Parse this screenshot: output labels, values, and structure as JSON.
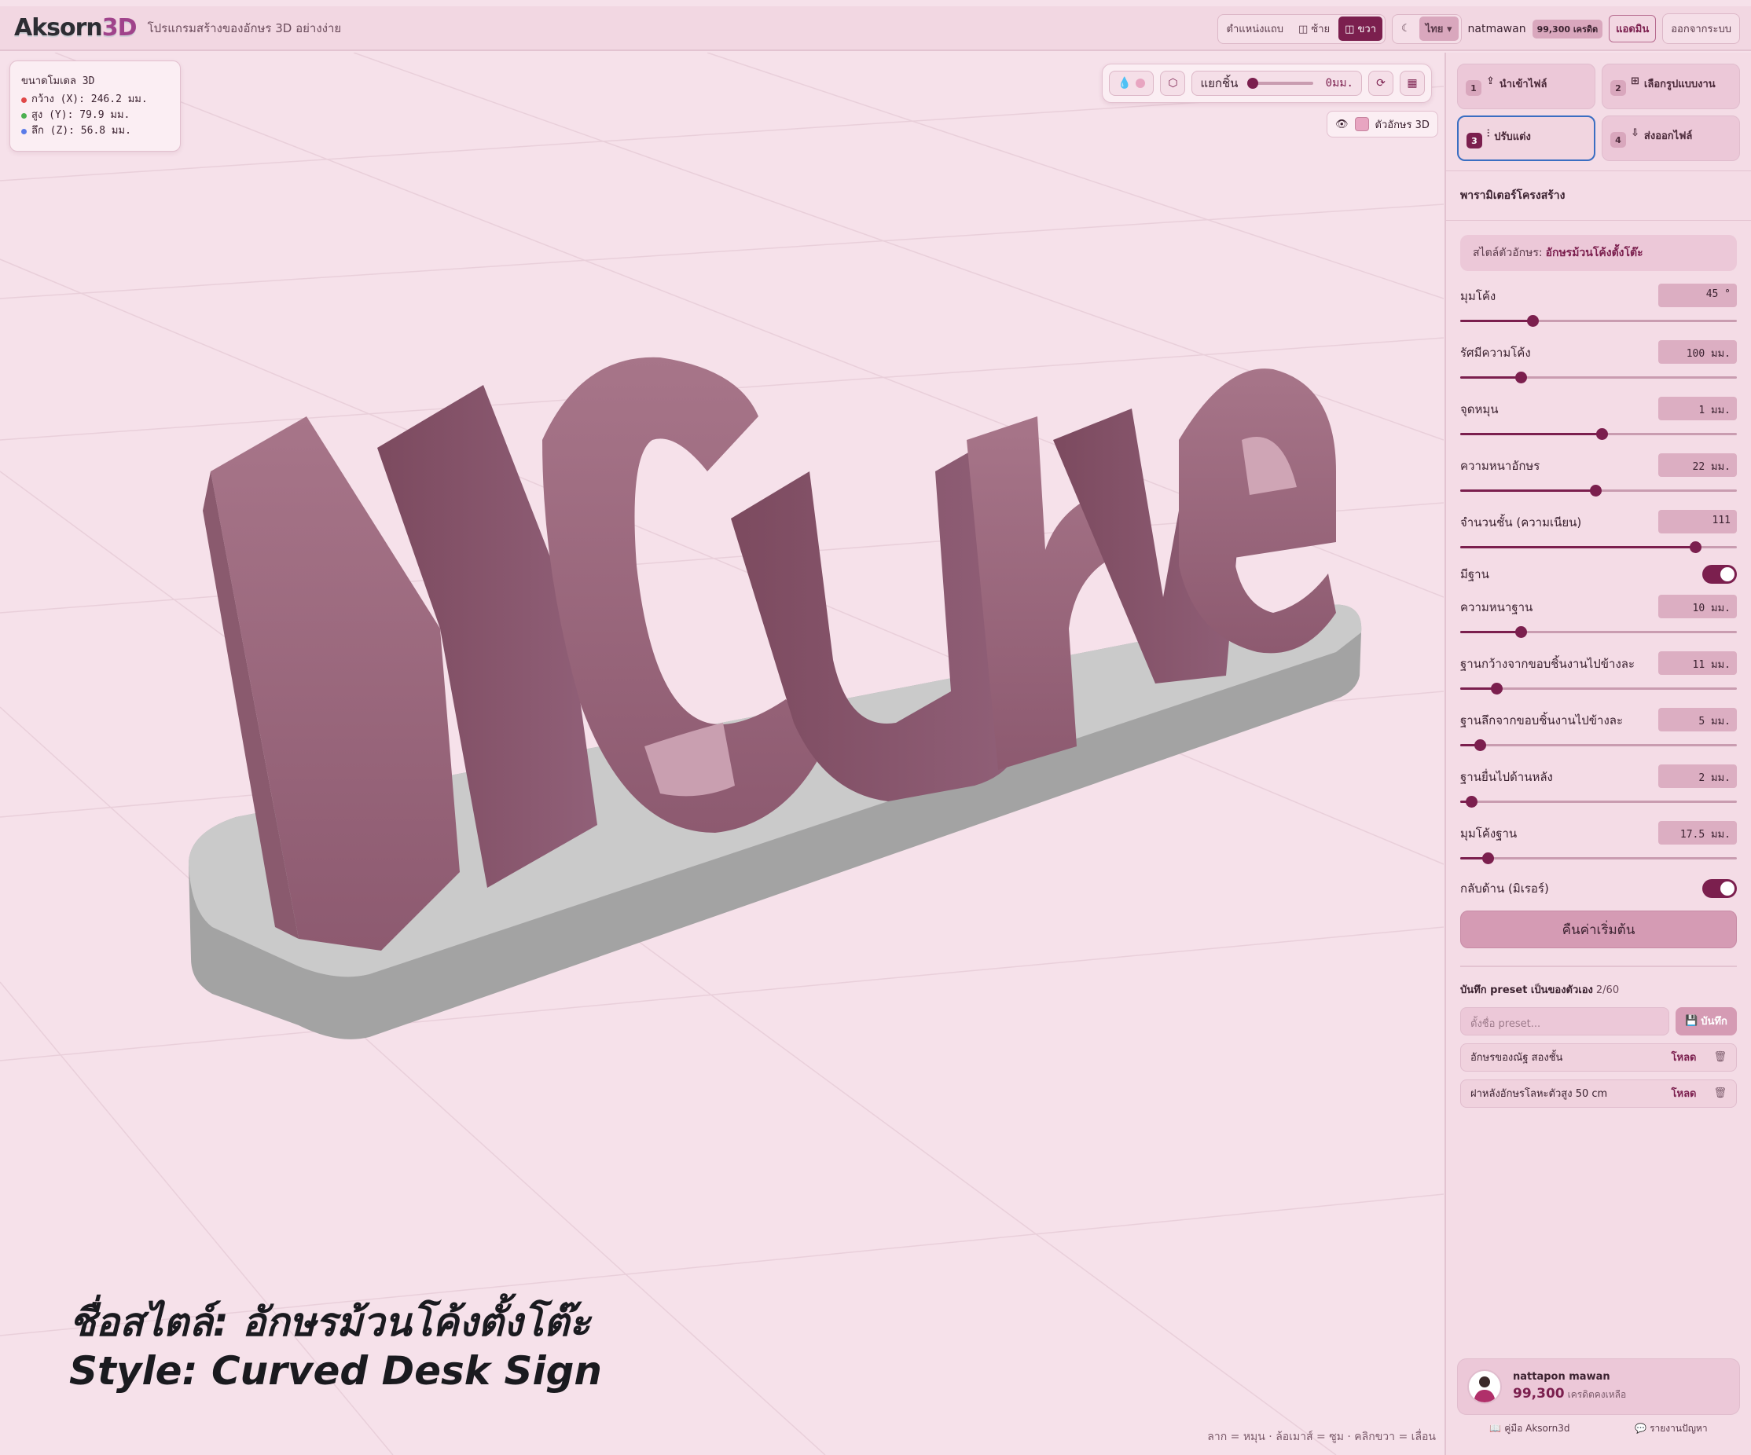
{
  "header": {
    "logo_main": "Aksorn",
    "logo_accent": "3D",
    "tagline": "โปรแกรมสร้างของอักษร 3D อย่างง่าย",
    "panel_position_label": "ตำแหน่งแถบ",
    "left_label": "ซ้าย",
    "right_label": "ขวา",
    "language": "ไทย",
    "username": "natmawan",
    "credits_badge": "99,300 เครดิต",
    "admin_label": "แอดมิน",
    "logout_label": "ออกจากระบบ"
  },
  "viewport": {
    "dims_title": "ขนาดโมเดล 3D",
    "dims": [
      {
        "label": "กว้าง (X): 246.2 มม.",
        "color": "#e04848"
      },
      {
        "label": "สูง (Y): 79.9 มม.",
        "color": "#4caf50"
      },
      {
        "label": "ลึก (Z): 56.8 มม.",
        "color": "#5a7be8"
      }
    ],
    "separate_label": "แยกชิ้น",
    "separate_value": "0มม.",
    "text_layer_label": "ตัวอักษร 3D",
    "model_text": "NCurve",
    "caption_th": "ชื่อสไตล์: อักษรม้วนโค้งตั้งโต๊ะ",
    "caption_en": "Style: Curved Desk Sign",
    "hint": "ลาก = หมุน · ล้อเมาส์ = ซูม · คลิกขวา = เลื่อน",
    "letter_color": "#a87488",
    "base_color": "#c9c9c9"
  },
  "panel": {
    "steps": [
      {
        "num": "1",
        "label": "นำเข้าไฟล์",
        "icon": "upload-icon",
        "active": false
      },
      {
        "num": "2",
        "label": "เลือกรูปแบบงาน",
        "icon": "grid-icon",
        "active": false
      },
      {
        "num": "3",
        "label": "ปรับแต่ง",
        "icon": "sliders-icon",
        "active": true
      },
      {
        "num": "4",
        "label": "ส่งออกไฟล์",
        "icon": "download-icon",
        "active": false
      }
    ],
    "title": "พารามิเตอร์โครงสร้าง",
    "style_prefix": "สไตล์ตัวอักษร:",
    "style_name": "อักษรม้วนโค้งตั้งโต๊ะ",
    "params_a": [
      {
        "label": "มุมโค้ง",
        "value": "45 °",
        "fraction": 0.26
      },
      {
        "label": "รัศมีความโค้ง",
        "value": "100 มม.",
        "fraction": 0.22
      },
      {
        "label": "จุดหมุน",
        "value": "1 มม.",
        "fraction": 0.51
      },
      {
        "label": "ความหนาอักษร",
        "value": "22 มม.",
        "fraction": 0.49
      },
      {
        "label": "จำนวนชั้น (ความเนียน)",
        "value": "111",
        "fraction": 0.85
      }
    ],
    "base_toggle_label": "มีฐาน",
    "params_b": [
      {
        "label": "ความหนาฐาน",
        "value": "10 มม.",
        "fraction": 0.22
      },
      {
        "label": "ฐานกว้างจากขอบชิ้นงานไปข้างละ",
        "value": "11 มม.",
        "fraction": 0.13
      },
      {
        "label": "ฐานลึกจากขอบชิ้นงานไปข้างละ",
        "value": "5 มม.",
        "fraction": 0.07
      },
      {
        "label": "ฐานยื่นไปด้านหลัง",
        "value": "2 มม.",
        "fraction": 0.04
      },
      {
        "label": "มุมโค้งฐาน",
        "value": "17.5 มม.",
        "fraction": 0.1
      }
    ],
    "mirror_label": "กลับด้าน (มิเรอร์)",
    "reset_label": "คืนค่าเริ่มต้น",
    "presets_title": "บันทึก preset เป็นของตัวเอง",
    "presets_count": "2/60",
    "preset_placeholder": "ตั้งชื่อ preset...",
    "save_label": "บันทึก",
    "presets": [
      {
        "name": "อักษรของณัฐ สองชั้น",
        "load": "โหลด"
      },
      {
        "name": "ฝาหลังอักษรโลหะตัวสูง 50 cm",
        "load": "โหลด"
      }
    ],
    "profile_name": "nattapon mawan",
    "profile_credits": "99,300",
    "profile_credits_label": "เครดิตคงเหลือ",
    "guide_label": "คู่มือ Aksorn3d",
    "report_label": "รายงานปัญหา"
  },
  "colors": {
    "accent": "#7b1f4e",
    "active_border": "#3a6ec2"
  }
}
